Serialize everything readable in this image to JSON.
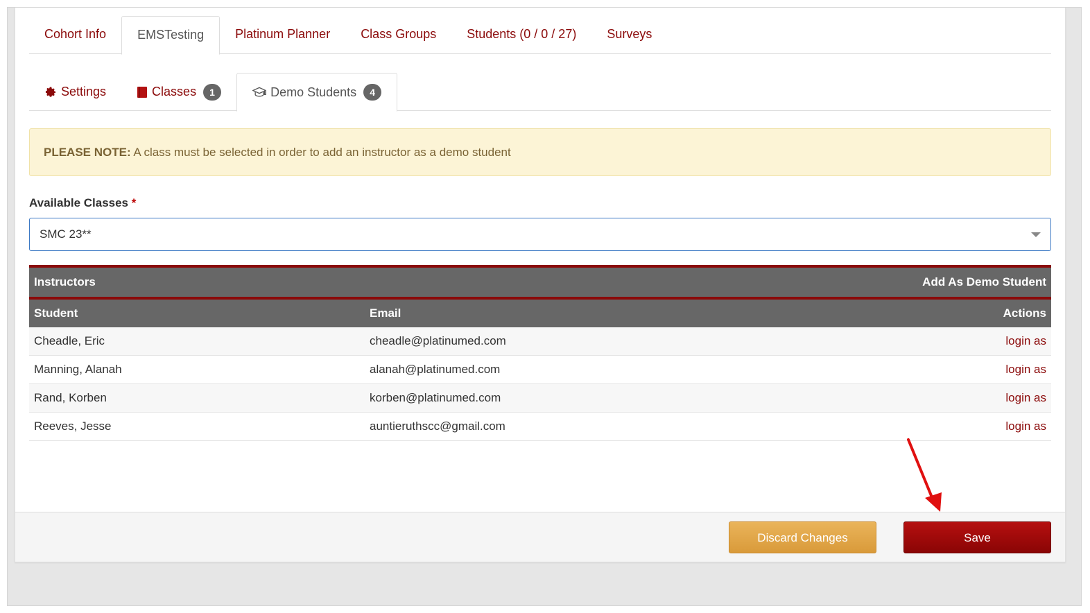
{
  "top_tabs": [
    {
      "label": "Cohort Info"
    },
    {
      "label": "EMSTesting"
    },
    {
      "label": "Platinum Planner"
    },
    {
      "label": "Class Groups"
    },
    {
      "label": "Students (0 / 0 / 27)"
    },
    {
      "label": "Surveys"
    }
  ],
  "sub_tabs": [
    {
      "label": "Settings",
      "icon": "gear-icon"
    },
    {
      "label": "Classes",
      "icon": "book-icon",
      "badge": "1"
    },
    {
      "label": "Demo Students",
      "icon": "graduation-cap-icon",
      "badge": "4"
    }
  ],
  "alert": {
    "title": "PLEASE NOTE:",
    "text": " A class must be selected in order to add an instructor as a demo student"
  },
  "available_classes": {
    "label": "Available Classes",
    "required": "*",
    "selected": "SMC 23**"
  },
  "table": {
    "group_header": "Instructors",
    "group_action": "Add As Demo Student",
    "columns": {
      "student": "Student",
      "email": "Email",
      "actions": "Actions"
    },
    "rows": [
      {
        "student": "Cheadle, Eric",
        "email": "cheadle@platinumed.com",
        "action": "login as"
      },
      {
        "student": "Manning, Alanah",
        "email": "alanah@platinumed.com",
        "action": "login as"
      },
      {
        "student": "Rand, Korben",
        "email": "korben@platinumed.com",
        "action": "login as"
      },
      {
        "student": "Reeves, Jesse",
        "email": "auntieruthscc@gmail.com",
        "action": "login as"
      }
    ]
  },
  "footer": {
    "discard_label": "Discard Changes",
    "save_label": "Save"
  },
  "colors": {
    "brand_red": "#8b0a0a",
    "discard_orange": "#e0a64a",
    "alert_bg": "#fcf4d6",
    "header_gray": "#676767"
  }
}
